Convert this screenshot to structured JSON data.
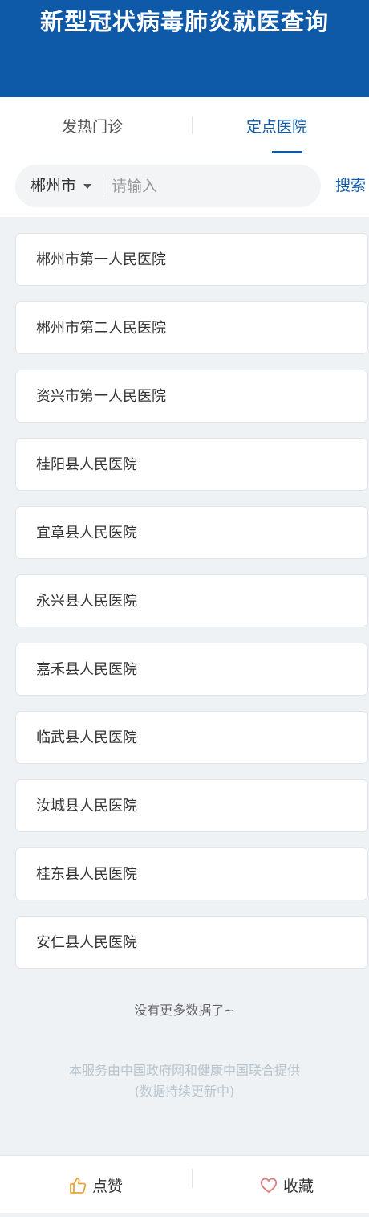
{
  "header": {
    "title": "新型冠状病毒肺炎就医查询"
  },
  "tabs": [
    {
      "label": "发热门诊",
      "active": false
    },
    {
      "label": "定点医院",
      "active": true
    }
  ],
  "search": {
    "city": "郴州市",
    "placeholder": "请输入",
    "value": "",
    "button_label": "搜索"
  },
  "hospitals": [
    "郴州市第一人民医院",
    "郴州市第二人民医院",
    "资兴市第一人民医院",
    "桂阳县人民医院",
    "宜章县人民医院",
    "永兴县人民医院",
    "嘉禾县人民医院",
    "临武县人民医院",
    "汝城县人民医院",
    "桂东县人民医院",
    "安仁县人民医院"
  ],
  "list_end_text": "没有更多数据了~",
  "footer": {
    "line1": "本服务由中国政府网和健康中国联合提供",
    "line2": "(数据持续更新中)"
  },
  "bottom_bar": {
    "like_label": "点赞",
    "favorite_label": "收藏",
    "like_icon": "thumbs-up-icon",
    "favorite_icon": "heart-icon"
  },
  "colors": {
    "brand": "#0f5aa8",
    "page_bg": "#eef2f5",
    "like_icon": "#e8a33d",
    "favorite_icon": "#e0787a"
  }
}
